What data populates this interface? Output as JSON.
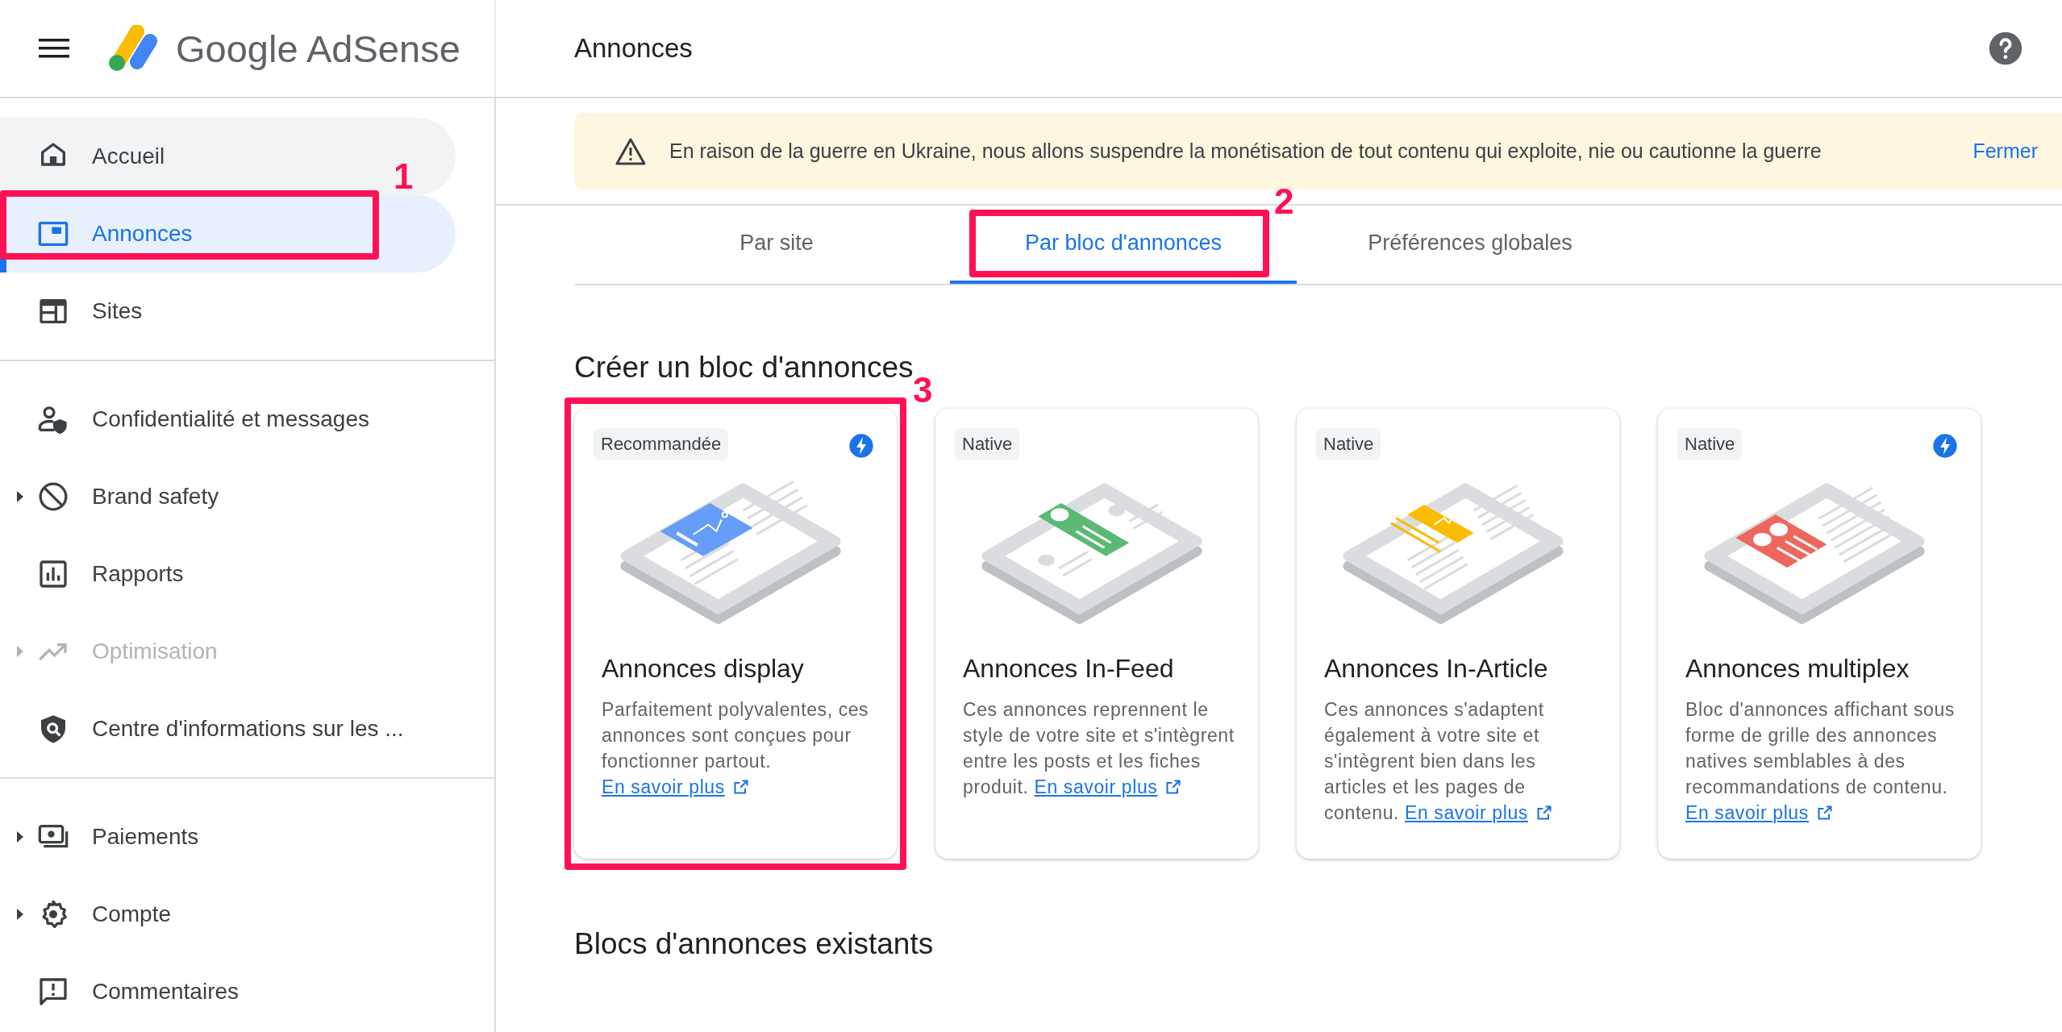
{
  "header": {
    "app_name": "Google AdSense",
    "page_title": "Annonces"
  },
  "sidebar": {
    "groups": [
      {
        "items": [
          {
            "label": "Accueil",
            "selected": false,
            "hovered": true,
            "disabled": false,
            "expandable": false
          },
          {
            "label": "Annonces",
            "selected": true,
            "hovered": false,
            "disabled": false,
            "expandable": false,
            "annotation": "1"
          },
          {
            "label": "Sites",
            "selected": false,
            "hovered": false,
            "disabled": false,
            "expandable": false
          }
        ]
      },
      {
        "items": [
          {
            "label": "Confidentialité et messages",
            "selected": false,
            "hovered": false,
            "disabled": false,
            "expandable": false
          },
          {
            "label": "Brand safety",
            "selected": false,
            "hovered": false,
            "disabled": false,
            "expandable": true
          },
          {
            "label": "Rapports",
            "selected": false,
            "hovered": false,
            "disabled": false,
            "expandable": false
          },
          {
            "label": "Optimisation",
            "selected": false,
            "hovered": false,
            "disabled": true,
            "expandable": true
          },
          {
            "label": "Centre d'informations sur les ...",
            "selected": false,
            "hovered": false,
            "disabled": false,
            "expandable": false
          }
        ]
      },
      {
        "items": [
          {
            "label": "Paiements",
            "selected": false,
            "hovered": false,
            "disabled": false,
            "expandable": true
          },
          {
            "label": "Compte",
            "selected": false,
            "hovered": false,
            "disabled": false,
            "expandable": true
          },
          {
            "label": "Commentaires",
            "selected": false,
            "hovered": false,
            "disabled": false,
            "expandable": false
          }
        ]
      }
    ]
  },
  "banner": {
    "message": "En raison de la guerre en Ukraine, nous allons suspendre la monétisation de tout contenu qui exploite, nie ou cautionne la guerre",
    "action": "Fermer"
  },
  "tabs": [
    {
      "label": "Par site",
      "selected": false
    },
    {
      "label": "Par bloc d'annonces",
      "selected": true,
      "annotation": "2"
    },
    {
      "label": "Préférences globales",
      "selected": false
    }
  ],
  "create_section": {
    "title": "Créer un bloc d'annonces",
    "cards": [
      {
        "kind": "display",
        "color": "#669df6",
        "chip": "Recommandée",
        "amp": true,
        "title": "Annonces display",
        "description": "Parfaitement polyvalentes, ces annonces sont conçues pour fonctionner partout.",
        "link": "En savoir plus",
        "annotation": "3"
      },
      {
        "kind": "in-feed",
        "color": "#5bb974",
        "chip": "Native",
        "amp": false,
        "title": "Annonces In-Feed",
        "description": "Ces annonces reprennent le style de votre site et s'intègrent entre les posts et les fiches produit.",
        "link": "En savoir plus"
      },
      {
        "kind": "in-article",
        "color": "#fbbc04",
        "chip": "Native",
        "amp": false,
        "title": "Annonces In-Article",
        "description": "Ces annonces s'adaptent également à votre site et s'intègrent bien dans les articles et les pages de contenu.",
        "link": "En savoir plus"
      },
      {
        "kind": "multiplex",
        "color": "#ee675c",
        "chip": "Native",
        "amp": true,
        "title": "Annonces multiplex",
        "description": "Bloc d'annonces affichant sous forme de grille des annonces natives semblables à des recommandations de contenu.",
        "link": "En savoir plus"
      }
    ]
  },
  "existing_section": {
    "title": "Blocs d'annonces existants"
  }
}
